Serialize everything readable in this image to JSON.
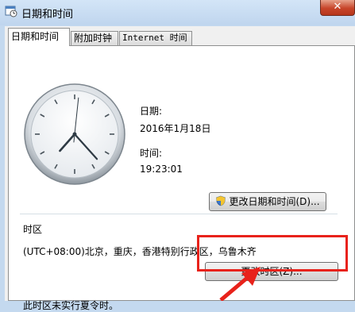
{
  "window": {
    "title": "日期和时间",
    "close_label": "✕"
  },
  "tabs": [
    {
      "label": "日期和时间",
      "active": true
    },
    {
      "label": "附加时钟",
      "active": false
    },
    {
      "label": "Internet 时间",
      "active": false
    }
  ],
  "clock": {
    "hour": 19,
    "minute": 23,
    "second": 1
  },
  "date": {
    "label": "日期:",
    "value": "2016年1月18日"
  },
  "time": {
    "label": "时间:",
    "value": "19:23:01"
  },
  "buttons": {
    "change_datetime": "更改日期和时间(D)...",
    "change_timezone": "更改时区(Z)..."
  },
  "timezone": {
    "section_label": "时区",
    "value": "(UTC+08:00)北京，重庆，香港特别行政区，乌鲁木齐",
    "dst_note": "此时区未实行夏令时。"
  },
  "colors": {
    "highlight": "#e8221b",
    "accent": "#c4d9ef"
  }
}
